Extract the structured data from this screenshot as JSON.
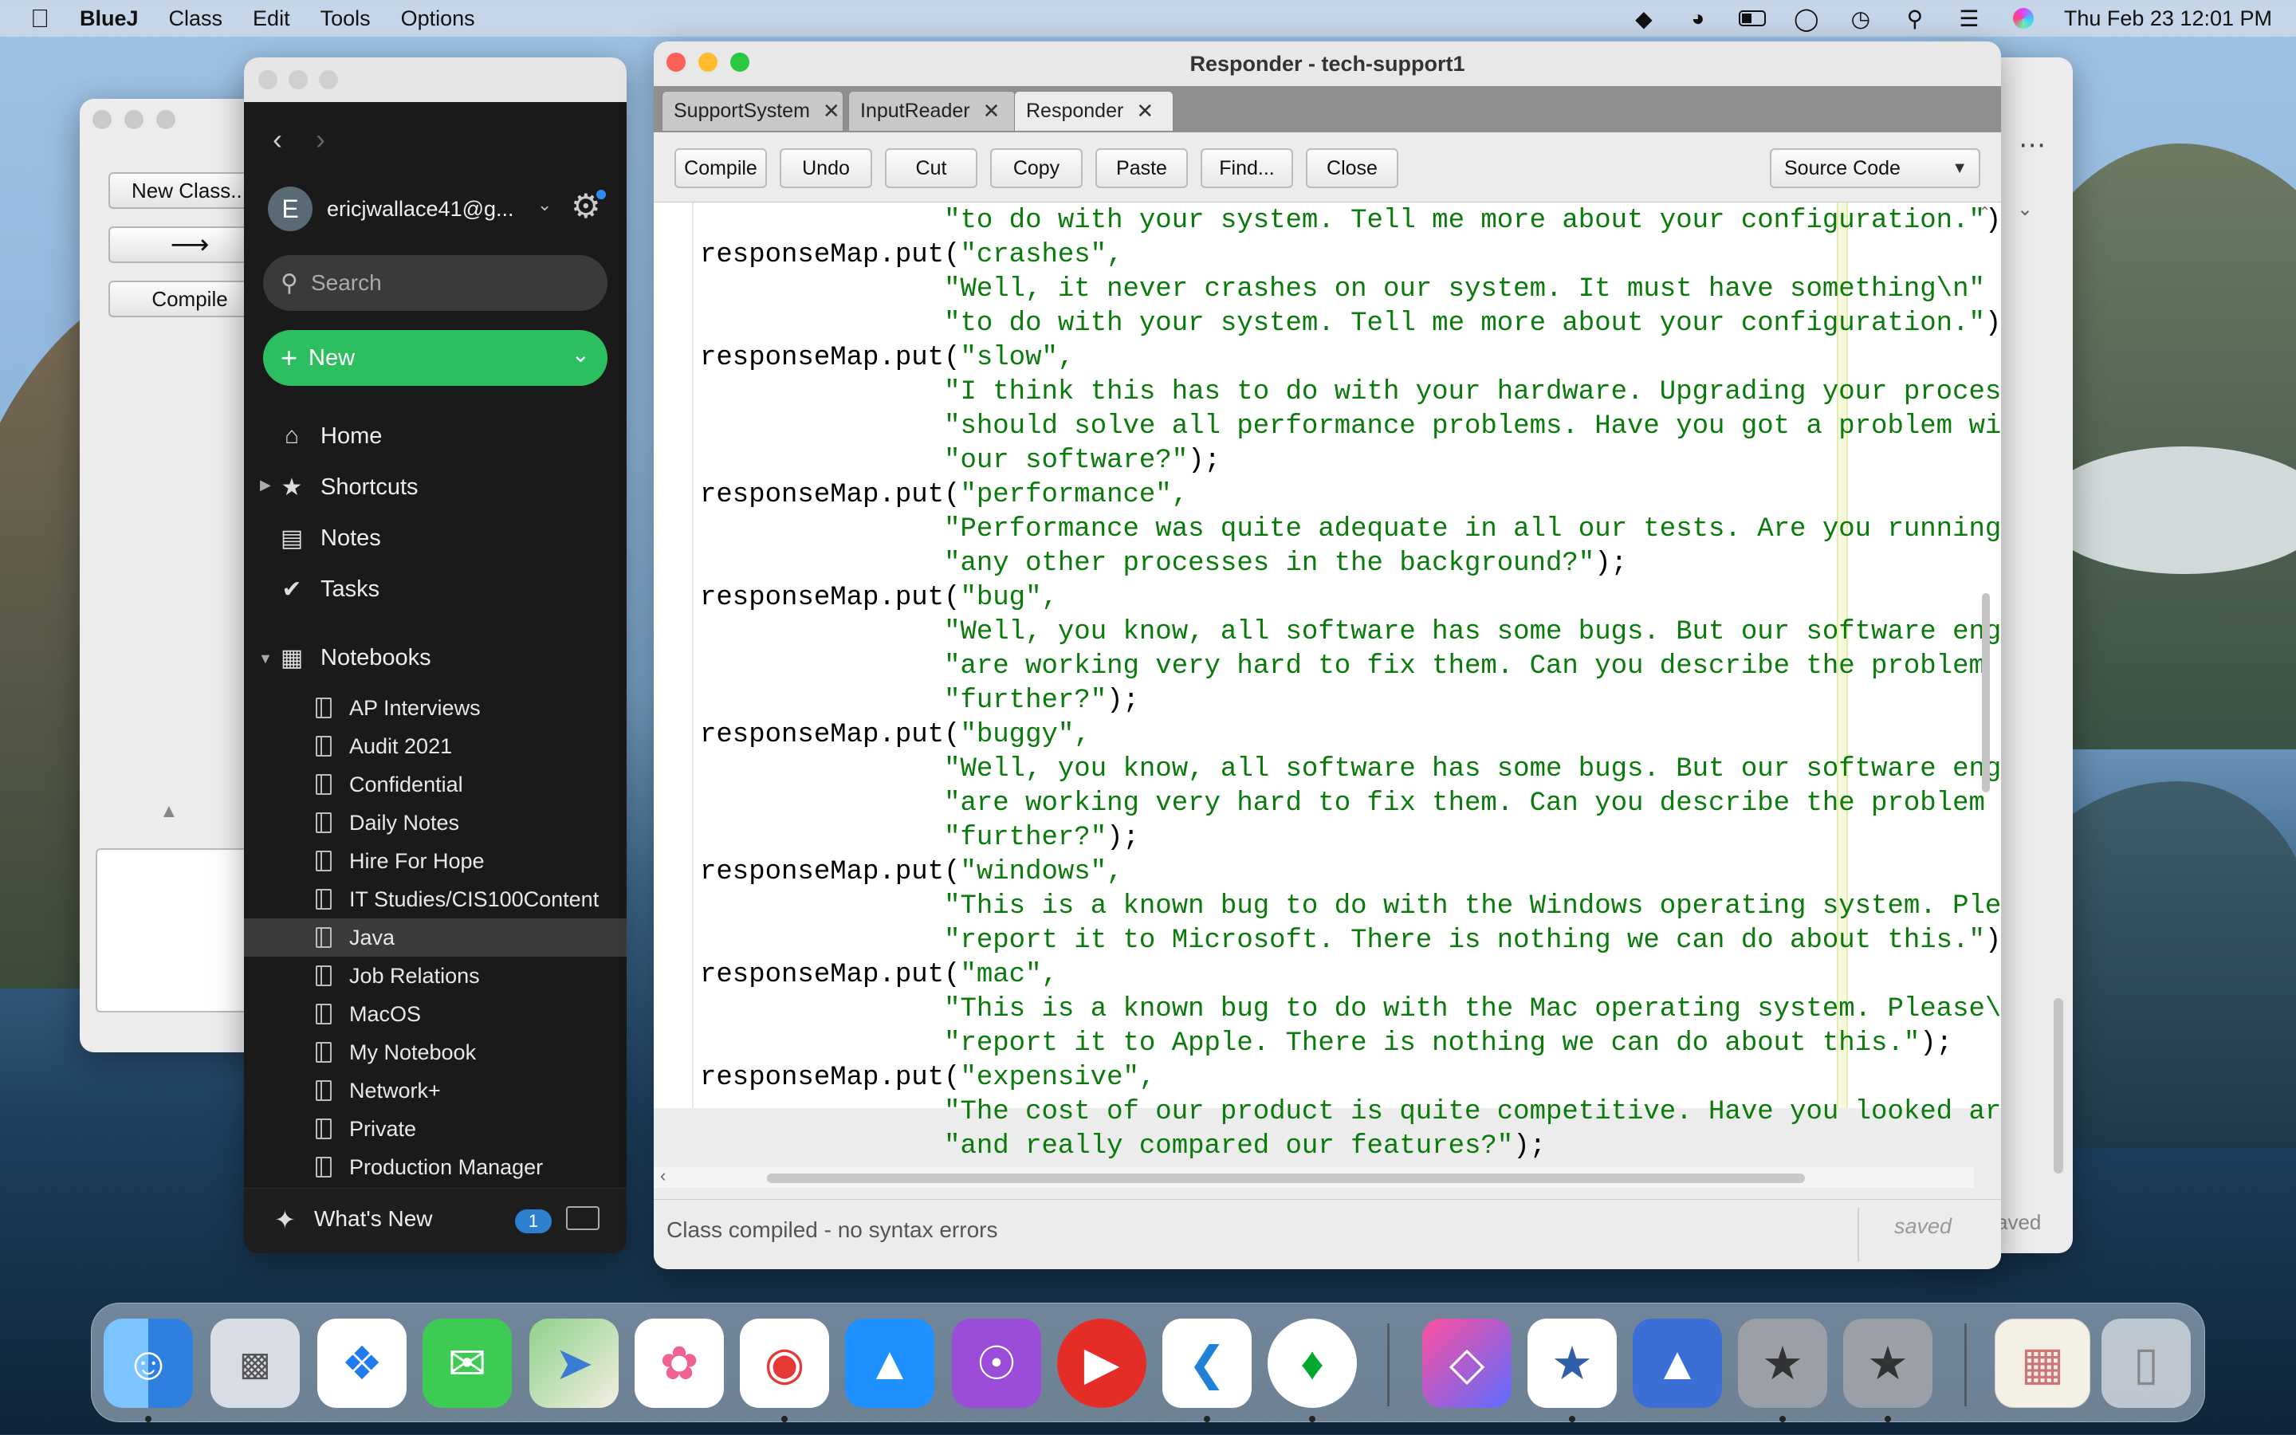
{
  "menubar": {
    "app_name": "BlueJ",
    "menus": [
      "Class",
      "Edit",
      "Tools",
      "Options"
    ],
    "clock": "Thu Feb 23  12:01 PM"
  },
  "bluej_main": {
    "new_class_label": "New Class...",
    "compile_label": "Compile"
  },
  "evernote": {
    "account": "ericjwallace41@g...",
    "avatar_letter": "E",
    "search_placeholder": "Search",
    "new_label": "New",
    "nav": [
      "Home",
      "Shortcuts",
      "Notes",
      "Tasks"
    ],
    "notebooks_label": "Notebooks",
    "notebooks": [
      "AP Interviews",
      "Audit 2021",
      "Confidential",
      "Daily Notes",
      "Hire For Hope",
      "IT Studies/CIS100Content",
      "Java",
      "Job Relations",
      "MacOS",
      "My Notebook",
      "Network+",
      "Private",
      "Production Manager"
    ],
    "selected_notebook": "Java",
    "whats_new_label": "What's New",
    "whats_new_count": "1"
  },
  "editor": {
    "title": "Responder - tech-support1",
    "tabs": [
      "SupportSystem",
      "InputReader",
      "Responder"
    ],
    "active_tab": "Responder",
    "toolbar": [
      "Compile",
      "Undo",
      "Cut",
      "Copy",
      "Paste",
      "Find...",
      "Close"
    ],
    "view_select": "Source Code",
    "code_lines": [
      {
        "indent": "               ",
        "text": "\"to do with your system. Tell me more about your configuration.\");",
        "kind": "str"
      },
      {
        "indent": "",
        "text": "responseMap.put(",
        "str": "\"crashes\",",
        "kind": "put"
      },
      {
        "indent": "               ",
        "text": "\"Well, it never crashes on our system. It must have something\\n\" +",
        "kind": "str"
      },
      {
        "indent": "               ",
        "text": "\"to do with your system. Tell me more about your configuration.\");",
        "kind": "str"
      },
      {
        "indent": "",
        "text": "responseMap.put(",
        "str": "\"slow\",",
        "kind": "put"
      },
      {
        "indent": "               ",
        "text": "\"I think this has to do with your hardware. Upgrading your processor",
        "kind": "str"
      },
      {
        "indent": "               ",
        "text": "\"should solve all performance problems. Have you got a problem with\\",
        "kind": "str"
      },
      {
        "indent": "               ",
        "text": "\"our software?\");",
        "kind": "str"
      },
      {
        "indent": "",
        "text": "responseMap.put(",
        "str": "\"performance\",",
        "kind": "put"
      },
      {
        "indent": "               ",
        "text": "\"Performance was quite adequate in all our tests. Are you running\\n\"",
        "kind": "str"
      },
      {
        "indent": "               ",
        "text": "\"any other processes in the background?\");",
        "kind": "str"
      },
      {
        "indent": "",
        "text": "responseMap.put(",
        "str": "\"bug\",",
        "kind": "put"
      },
      {
        "indent": "               ",
        "text": "\"Well, you know, all software has some bugs. But our software engine",
        "kind": "str"
      },
      {
        "indent": "               ",
        "text": "\"are working very hard to fix them. Can you describe the problem a b",
        "kind": "str"
      },
      {
        "indent": "               ",
        "text": "\"further?\");",
        "kind": "str"
      },
      {
        "indent": "",
        "text": "responseMap.put(",
        "str": "\"buggy\",",
        "kind": "put"
      },
      {
        "indent": "               ",
        "text": "\"Well, you know, all software has some bugs. But our software engine",
        "kind": "str"
      },
      {
        "indent": "               ",
        "text": "\"are working very hard to fix them. Can you describe the problem a b",
        "kind": "str"
      },
      {
        "indent": "               ",
        "text": "\"further?\");",
        "kind": "str"
      },
      {
        "indent": "",
        "text": "responseMap.put(",
        "str": "\"windows\",",
        "kind": "put"
      },
      {
        "indent": "               ",
        "text": "\"This is a known bug to do with the Windows operating system. Please",
        "kind": "str"
      },
      {
        "indent": "               ",
        "text": "\"report it to Microsoft. There is nothing we can do about this.\");",
        "kind": "str"
      },
      {
        "indent": "",
        "text": "responseMap.put(",
        "str": "\"mac\",",
        "kind": "put"
      },
      {
        "indent": "               ",
        "text": "\"This is a known bug to do with the Mac operating system. Please\\n\"",
        "kind": "str"
      },
      {
        "indent": "               ",
        "text": "\"report it to Apple. There is nothing we can do about this.\");",
        "kind": "str"
      },
      {
        "indent": "",
        "text": "responseMap.put(",
        "str": "\"expensive\",",
        "kind": "put"
      },
      {
        "indent": "               ",
        "text": "\"The cost of our product is quite competitive. Have you looked arour",
        "kind": "str"
      },
      {
        "indent": "               ",
        "text": "\"and really compared our features?\");",
        "kind": "str"
      }
    ],
    "status": "Class compiled - no syntax errors",
    "saved": "saved"
  },
  "behind_window_status": "aved",
  "dock_apps": [
    "finder-icon",
    "launchpad-icon",
    "safari-icon",
    "messages-icon",
    "maps-icon",
    "photos-icon",
    "chrome-icon",
    "app-store-icon",
    "podcasts-icon",
    "youtube-icon",
    "vscode-icon",
    "evernote-icon",
    "shortcuts-icon",
    "bluej-icon",
    "nordvpn-icon",
    "bluej-project-icon",
    "bluej-project-icon-2",
    "preview-icon",
    "trash-icon"
  ]
}
